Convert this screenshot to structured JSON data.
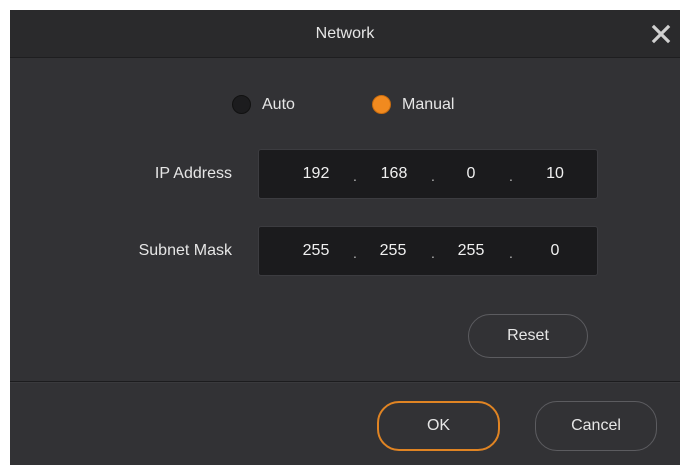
{
  "dialog": {
    "title": "Network",
    "close_icon": "close-icon"
  },
  "mode": {
    "options": [
      "Auto",
      "Manual"
    ],
    "selected": "Manual"
  },
  "ip_address": {
    "label": "IP Address",
    "octets": [
      "192",
      "168",
      "0",
      "10"
    ],
    "separator": "."
  },
  "subnet_mask": {
    "label": "Subnet Mask",
    "octets": [
      "255",
      "255",
      "255",
      "0"
    ],
    "separator": "."
  },
  "buttons": {
    "reset": "Reset",
    "ok": "OK",
    "cancel": "Cancel"
  },
  "colors": {
    "background": "#323235",
    "field": "#1b1b1d",
    "accent": "#f18a1f"
  }
}
